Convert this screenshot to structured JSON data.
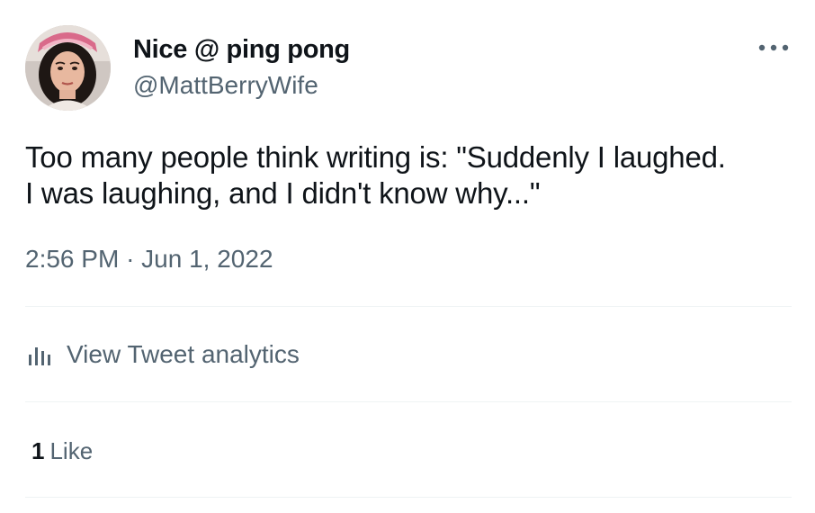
{
  "tweet": {
    "author": {
      "display_name": "Nice @ ping pong",
      "handle": "@MattBerryWife",
      "avatar_icon": "profile-photo"
    },
    "more_icon": "more-horizontal-icon",
    "text_lines": [
      "Too many people think writing is: \"Suddenly I laughed.",
      "I was laughing, and I didn't know why...\""
    ],
    "time": "2:56 PM",
    "separator": "·",
    "date": "Jun 1, 2022",
    "analytics": {
      "icon": "bar-chart-icon",
      "label": "View Tweet analytics"
    },
    "likes": {
      "count": "1",
      "label": "Like"
    }
  },
  "colors": {
    "primary_text": "#0f1419",
    "secondary_text": "#536471",
    "divider": "#eff3f4"
  }
}
